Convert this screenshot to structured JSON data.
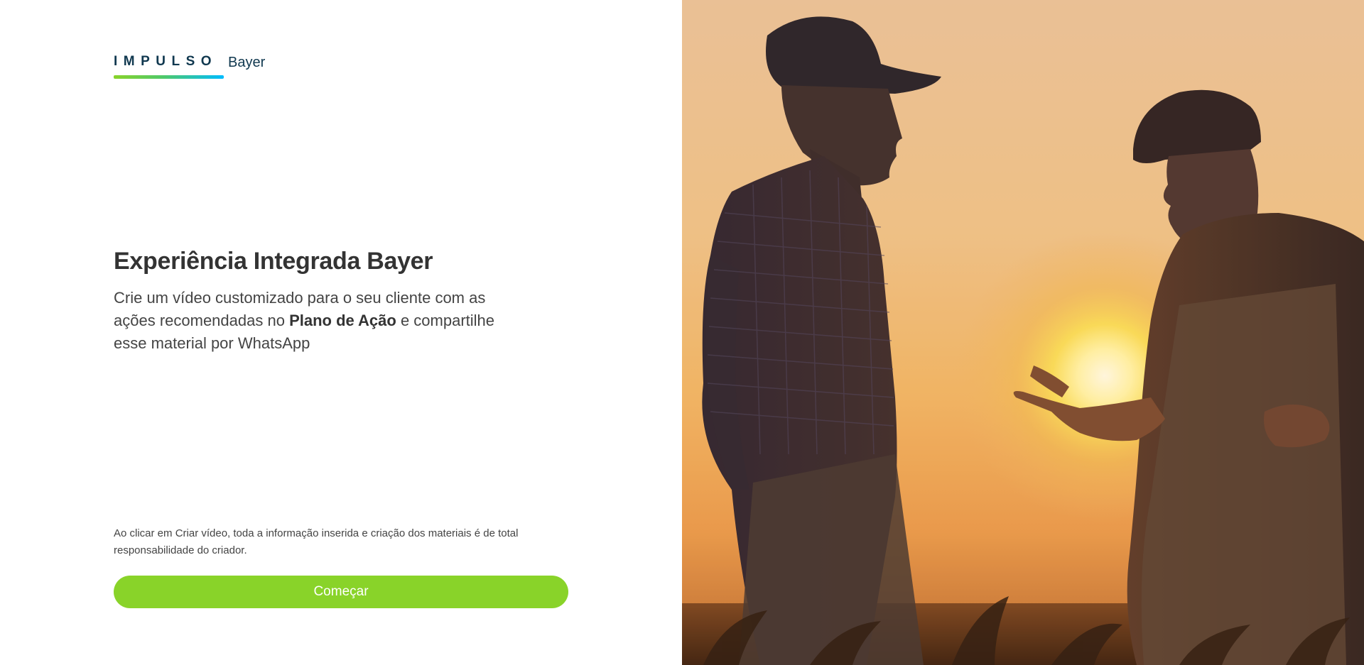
{
  "brand": {
    "impulso": "IMPULSO",
    "bayer": "Bayer"
  },
  "hero": {
    "title": "Experiência Integrada Bayer",
    "description_part1": "Crie um vídeo customizado para o seu cliente com as ações recomendadas no ",
    "description_bold": "Plano de Ação",
    "description_part2": " e compartilhe esse material por WhatsApp"
  },
  "disclaimer": "Ao clicar em Criar vídeo, toda a informação inserida e criação dos materiais é de total responsabilidade do criador.",
  "actions": {
    "start_label": "Começar"
  },
  "colors": {
    "accent_green": "#89d329",
    "brand_navy": "#10384f",
    "brand_blue": "#00bcff"
  },
  "image": {
    "alt": "hero-photo-farmers-sunset"
  }
}
